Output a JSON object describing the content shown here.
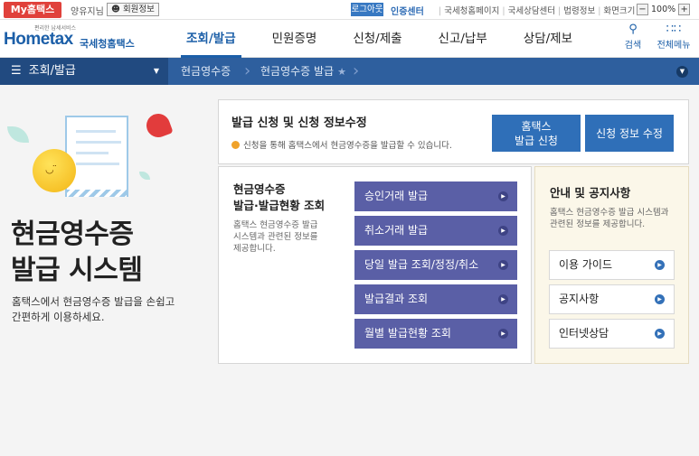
{
  "topbar": {
    "my_hometax": "My홈택스",
    "username": "양유지님",
    "member_info": "회원정보",
    "login": "로그아웃",
    "cert_center": "인증센터",
    "links": [
      "국세청홈페이지",
      "국세상담센터",
      "법령정보",
      "화면크기"
    ],
    "zoom_minus": "−",
    "zoom_value": "100%",
    "zoom_plus": "+"
  },
  "header": {
    "logo_tagline": "편리한 납세서비스",
    "logo_text": "Hometax",
    "logo_org": "국세청홈택스",
    "nav": [
      "조회/발급",
      "민원증명",
      "신청/제출",
      "신고/납부",
      "상담/제보"
    ],
    "search_label": "검색",
    "menu_label": "전체메뉴"
  },
  "location": {
    "menu": "조회/발급",
    "crumbs": [
      "현금영수증",
      "현금영수증 발급"
    ]
  },
  "hero": {
    "title_line1": "현금영수증",
    "title_line2": "발급 시스템",
    "desc_line1": "홈택스에서 현금영수증 발급을 손쉽고",
    "desc_line2": "간편하게 이용하세요."
  },
  "apply": {
    "title": "발급 신청 및 신청 정보수정",
    "desc": "신청을 통해 홈택스에서 현금영수증을 발급할 수 있습니다.",
    "btn_apply_line1": "홈택스",
    "btn_apply_line2": "발급 신청",
    "btn_edit": "신청 정보 수정"
  },
  "issue": {
    "title_line1": "현금영수증",
    "title_line2": "발급·발급현황 조회",
    "desc_line1": "홈택스 현금영수증 발급",
    "desc_line2": "시스템과 관련된 정보를",
    "desc_line3": "제공합니다.",
    "buttons": [
      "승인거래 발급",
      "취소거래 발급",
      "당일 발급 조회/정정/취소",
      "발급결과 조회",
      "월별 발급현황 조회"
    ]
  },
  "notice": {
    "title": "안내 및 공지사항",
    "desc_line1": "홈택스 현금영수증 발급 시스템과",
    "desc_line2": "관련된 정보를 제공합니다.",
    "buttons": [
      "이용 가이드",
      "공지사항",
      "인터넷상담"
    ]
  }
}
